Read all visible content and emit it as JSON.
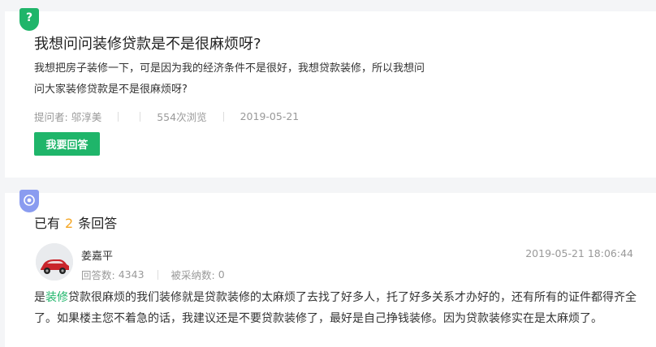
{
  "question": {
    "badge": "?",
    "title": "我想问问装修贷款是不是很麻烦呀?",
    "body_line1": "我想把房子装修一下，可是因为我的经济条件不是很好，我想贷款装修，所以我想问",
    "body_line2": "问大家装修贷款是不是很麻烦呀?",
    "asker_label": "提问者:",
    "asker_name": "邬淳美",
    "views": "554次浏览",
    "date": "2019-05-21",
    "answer_button": "我要回答"
  },
  "answers_header": {
    "prefix": "已有",
    "count": "2",
    "suffix": "条回答"
  },
  "answer": {
    "name": "姜嘉平",
    "answer_count_label": "回答数:",
    "answer_count": "4343",
    "adopted_label": "被采纳数:",
    "adopted_count": "0",
    "time": "2019-05-21 18:06:44",
    "body_prefix": "是",
    "body_keyword": "装修",
    "body_rest": "贷款很麻烦的我们装修就是贷款装修的太麻烦了去找了好多人，托了好多关系才办好的，还有所有的证件都得齐全了。如果楼主您不着急的话，我建议还是不要贷款装修了，最好是自己挣钱装修。因为贷款装修实在是太麻烦了。"
  },
  "colors": {
    "accent_green": "#1fb56a",
    "highlight_orange": "#f5a623",
    "answer_badge": "#8a9cf0"
  }
}
